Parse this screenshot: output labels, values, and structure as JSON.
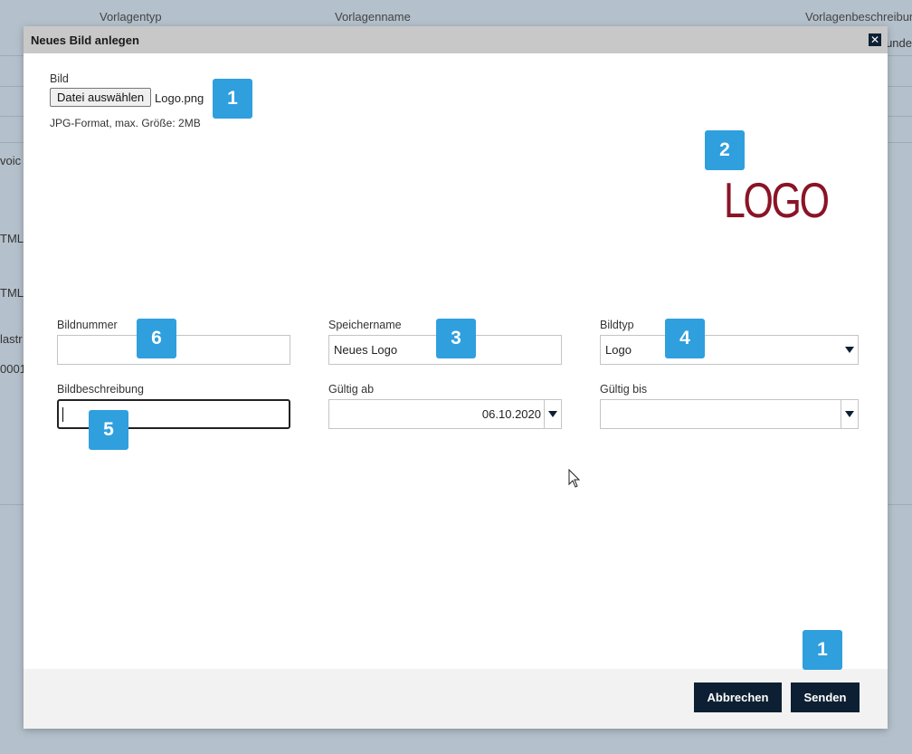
{
  "background": {
    "columns": [
      "Vorlagentyp",
      "Vorlagenname",
      "Vorlagenbeschreibun"
    ],
    "right_fragment": "unde",
    "left_fragments": [
      "voic",
      "TML)",
      "TML",
      "lastr",
      "0001"
    ]
  },
  "modal": {
    "title": "Neues Bild anlegen",
    "close_label": "✕",
    "image_section": {
      "label": "Bild",
      "choose_button": "Datei auswählen",
      "file_name": "Logo.png",
      "hint": "JPG-Format, max. Größe: 2MB"
    },
    "preview_text": "LOGO",
    "fields": {
      "bildnummer": {
        "label": "Bildnummer",
        "value": ""
      },
      "speichername": {
        "label": "Speichername",
        "value": "Neues Logo"
      },
      "bildtyp": {
        "label": "Bildtyp",
        "value": "Logo"
      },
      "bildbeschreibung": {
        "label": "Bildbeschreibung",
        "value": ""
      },
      "gueltig_ab": {
        "label": "Gültig ab",
        "value": "06.10.2020"
      },
      "gueltig_bis": {
        "label": "Gültig bis",
        "value": ""
      }
    },
    "buttons": {
      "cancel": "Abbrechen",
      "submit": "Senden"
    }
  },
  "badges": [
    "1",
    "2",
    "3",
    "4",
    "5",
    "6",
    "1"
  ],
  "colors": {
    "badge": "#2f9fde",
    "primary_button": "#0d2033",
    "logo": "#8a1426",
    "backdrop": "#b4c0cb"
  }
}
